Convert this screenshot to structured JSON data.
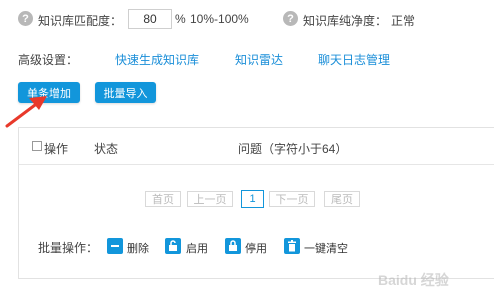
{
  "settings": {
    "match_label": "知识库匹配度：",
    "match_value": "80",
    "match_unit": "%",
    "match_range": "10%-100%",
    "purity_label": "知识库纯净度：",
    "purity_value": "正常",
    "help_glyph": "?"
  },
  "advanced": {
    "label": "高级设置：",
    "links": [
      "快速生成知识库",
      "知识雷达",
      "聊天日志管理"
    ]
  },
  "actions": {
    "add_single": "单条增加",
    "batch_import": "批量导入"
  },
  "table": {
    "col_operation": "操作",
    "col_status": "状态",
    "col_question": "问题（字符小于64）"
  },
  "pagination": {
    "first": "首页",
    "prev": "上一页",
    "current": "1",
    "next": "下一页",
    "last": "尾页"
  },
  "bulk": {
    "label": "批量操作：",
    "delete": "删除",
    "enable": "启用",
    "disable": "停用",
    "clear": "一键清空"
  },
  "watermark": "Baidu 经验",
  "colors": {
    "accent": "#1296db",
    "link": "#1a8ed8",
    "arrow": "#e8392b"
  },
  "icons": {
    "help": "question-circle-icon",
    "delete": "minus-icon",
    "enable": "unlock-icon",
    "disable": "lock-icon",
    "clear": "trash-icon",
    "pointer": "red-arrow-icon"
  }
}
